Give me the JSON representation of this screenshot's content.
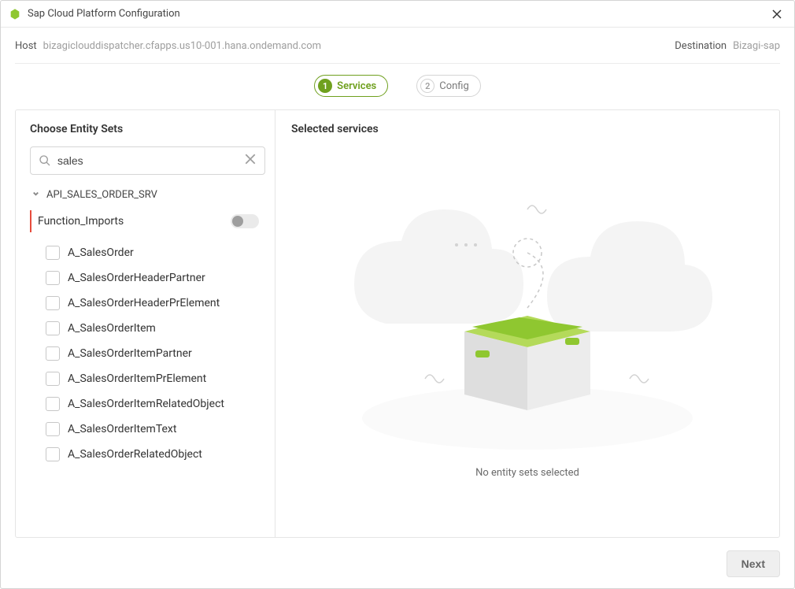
{
  "window": {
    "title": "Sap Cloud Platform Configuration"
  },
  "info": {
    "host_label": "Host",
    "host_value": "bizagiclouddispatcher.cfapps.us10-001.hana.ondemand.com",
    "destination_label": "Destination",
    "destination_value": "Bizagi-sap"
  },
  "steps": {
    "step1_num": "1",
    "step1_label": "Services",
    "step2_num": "2",
    "step2_label": "Config"
  },
  "left": {
    "heading": "Choose Entity Sets",
    "search_value": "sales",
    "tree_root": "API_SALES_ORDER_SRV",
    "function_imports": "Function_Imports",
    "items": [
      "A_SalesOrder",
      "A_SalesOrderHeaderPartner",
      "A_SalesOrderHeaderPrElement",
      "A_SalesOrderItem",
      "A_SalesOrderItemPartner",
      "A_SalesOrderItemPrElement",
      "A_SalesOrderItemRelatedObject",
      "A_SalesOrderItemText",
      "A_SalesOrderRelatedObject"
    ]
  },
  "right": {
    "heading": "Selected services",
    "empty_message": "No entity sets selected"
  },
  "footer": {
    "next": "Next"
  }
}
